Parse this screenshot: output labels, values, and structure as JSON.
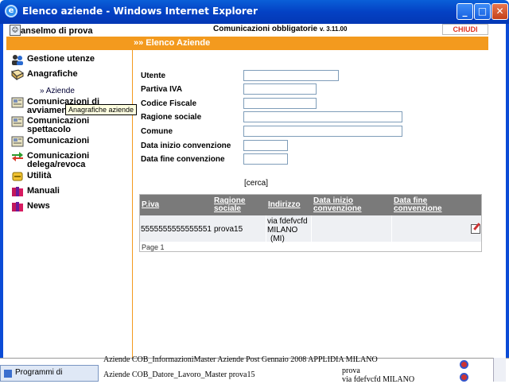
{
  "window": {
    "title": "Elenco aziende - Windows Internet Explorer",
    "buttons": {
      "minimize": "_",
      "maximize": "□",
      "close": "✕"
    }
  },
  "header": {
    "username": "anselmo di prova",
    "app_title": "Comunicazioni obbligatorie",
    "version": "v. 3.11.00",
    "close_label": "CHIUDI"
  },
  "breadcrumb": "»» Elenco Aziende",
  "sidebar": {
    "items": [
      {
        "label": "Gestione utenze",
        "icon": "users-icon"
      },
      {
        "label": "Anagrafiche",
        "icon": "book-icon"
      },
      {
        "label": "Comunicazioni di avviamento",
        "icon": "form-icon"
      },
      {
        "label": "Comunicazioni spettacolo",
        "icon": "form-icon"
      },
      {
        "label": "Comunicazioni",
        "icon": "form-icon"
      },
      {
        "label": "Comunicazioni delega/revoca",
        "icon": "arrows-icon"
      },
      {
        "label": "Utilità",
        "icon": "tools-icon"
      },
      {
        "label": "Manuali",
        "icon": "books-icon"
      },
      {
        "label": "News",
        "icon": "books-icon"
      }
    ],
    "subitem": "» Aziende",
    "tooltip": "Anagrafiche aziende"
  },
  "form": {
    "fields": [
      {
        "label": "Utente",
        "value": ""
      },
      {
        "label": "Partiva IVA",
        "value": ""
      },
      {
        "label": "Codice Fiscale",
        "value": ""
      },
      {
        "label": "Ragione sociale",
        "value": ""
      },
      {
        "label": "Comune",
        "value": ""
      },
      {
        "label": "Data inizio convenzione",
        "value": ""
      },
      {
        "label": "Data fine convenzione",
        "value": ""
      }
    ],
    "search_link": "[cerca]"
  },
  "table": {
    "headers": {
      "piva": "P.iva",
      "ragione_1": "Ragione",
      "ragione_2": "sociale",
      "indirizzo": "Indirizzo",
      "data_inizio_1": "Data inizio",
      "data_inizio_2": "convenzione",
      "data_fine_1": "Data fine",
      "data_fine_2": "convenzione"
    },
    "rows": [
      {
        "piva": "5555555555555551",
        "ragione": "prova15",
        "indirizzo_1": "via fdefvcfd",
        "indirizzo_2": "MILANO",
        "indirizzo_3": "(MI)",
        "data_inizio": "",
        "data_fine": ""
      }
    ],
    "pager": "Page 1"
  },
  "background_window": {
    "row1": "Aziende   COB_InformazioniMaster   Aziende Post Gennaio 2008 APPLIDIA   MILANO",
    "row2_a": "Aziende   COB_Datore_Lavoro_Master   prova15",
    "row2_b": "prova",
    "row2_c": "via fdefvcfd MILANO",
    "taskbar_item": "Programmi di"
  }
}
